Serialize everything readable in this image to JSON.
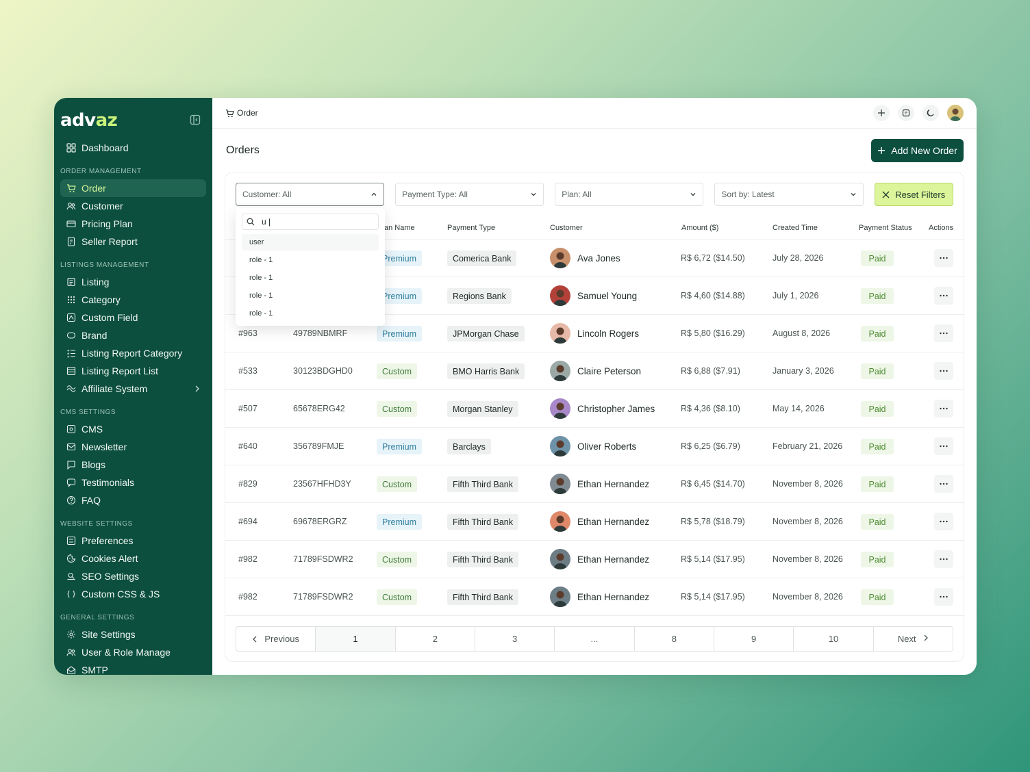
{
  "app": {
    "logo_main": "adv",
    "logo_accent": "az"
  },
  "sidebar": {
    "sections": [
      {
        "title": "ORDER MANAGEMENT",
        "items": [
          {
            "label": "Order",
            "icon": "cart-icon",
            "active": true
          },
          {
            "label": "Customer",
            "icon": "users-icon"
          },
          {
            "label": "Pricing Plan",
            "icon": "card-icon"
          },
          {
            "label": "Seller Report",
            "icon": "report-icon"
          }
        ]
      },
      {
        "title": "LISTINGS MANAGEMENT",
        "items": [
          {
            "label": "Listing",
            "icon": "list-icon"
          },
          {
            "label": "Category",
            "icon": "grid-dots-icon"
          },
          {
            "label": "Custom Field",
            "icon": "field-icon"
          },
          {
            "label": "Brand",
            "icon": "tag-icon"
          },
          {
            "label": "Listing Report Category",
            "icon": "list-check-icon"
          },
          {
            "label": "Listing Report List",
            "icon": "rows-icon"
          },
          {
            "label": "Affiliate System",
            "icon": "affiliate-icon",
            "chevron": true
          }
        ]
      },
      {
        "title": "CMS SETTINGS",
        "items": [
          {
            "label": "CMS",
            "icon": "cms-icon"
          },
          {
            "label": "Newsletter",
            "icon": "newsletter-icon"
          },
          {
            "label": "Blogs",
            "icon": "blog-icon"
          },
          {
            "label": "Testimonials",
            "icon": "chat-icon"
          },
          {
            "label": "FAQ",
            "icon": "help-icon"
          }
        ]
      },
      {
        "title": "WEBSITE SETTINGS",
        "items": [
          {
            "label": "Preferences",
            "icon": "sliders-icon"
          },
          {
            "label": "Cookies Alert",
            "icon": "cookie-icon"
          },
          {
            "label": "SEO Settings",
            "icon": "seo-icon"
          },
          {
            "label": "Custom CSS & JS",
            "icon": "code-icon"
          }
        ]
      },
      {
        "title": "GENERAL SETTINGS",
        "items": [
          {
            "label": "Site Settings",
            "icon": "gear-icon"
          },
          {
            "label": "User & Role Manage",
            "icon": "users-icon"
          },
          {
            "label": "SMTP",
            "icon": "mail-icon"
          }
        ]
      }
    ]
  },
  "topbar": {
    "breadcrumb": "Order"
  },
  "page": {
    "title": "Orders",
    "add_button": "Add New Order"
  },
  "filters": {
    "customer": "Customer: All",
    "payment_type": "Payment Type: All",
    "plan": "Plan: All",
    "sort": "Sort by: Latest",
    "reset": "Reset Filters"
  },
  "dropdown": {
    "search_value": "u |",
    "options": [
      "user",
      "role - 1",
      "role - 1",
      "role - 1",
      "role - 1"
    ]
  },
  "table": {
    "headers": {
      "plan_name": "an Name",
      "payment_type": "Payment Type",
      "customer": "Customer",
      "amount": "Amount ($)",
      "created": "Created Time",
      "status": "Payment Status",
      "actions": "Actions"
    },
    "rows": [
      {
        "id": "",
        "txn": "",
        "plan": "Premium",
        "bank": "Comerica Bank",
        "customer": "Ava Jones",
        "amount": "R$ 6,72 ($14.50)",
        "created": "July 28, 2026",
        "status": "Paid",
        "avatar_color": "#c8906a"
      },
      {
        "id": "",
        "txn": "",
        "plan": "Premium",
        "bank": "Regions Bank",
        "customer": "Samuel Young",
        "amount": "R$ 4,60 ($14.88)",
        "created": "July 1, 2026",
        "status": "Paid",
        "avatar_color": "#b2413a"
      },
      {
        "id": "#963",
        "txn": "49789NBMRF",
        "plan": "Premium",
        "bank": "JPMorgan Chase",
        "customer": "Lincoln Rogers",
        "amount": "R$ 5,80 ($16.29)",
        "created": "August 8, 2026",
        "status": "Paid",
        "avatar_color": "#e7b9a8"
      },
      {
        "id": "#533",
        "txn": "30123BDGHD0",
        "plan": "Custom",
        "bank": "BMO Harris Bank",
        "customer": "Claire Peterson",
        "amount": "R$ 6,88 ($7.91)",
        "created": "January 3, 2026",
        "status": "Paid",
        "avatar_color": "#9aa8a6"
      },
      {
        "id": "#507",
        "txn": "65678ERG42",
        "plan": "Custom",
        "bank": "Morgan Stanley",
        "customer": "Christopher James",
        "amount": "R$ 4,36 ($8.10)",
        "created": "May 14, 2026",
        "status": "Paid",
        "avatar_color": "#a888c8"
      },
      {
        "id": "#640",
        "txn": "356789FMJE",
        "plan": "Premium",
        "bank": "Barclays",
        "customer": "Oliver Roberts",
        "amount": "R$ 6,25 ($6.79)",
        "created": "February 21, 2026",
        "status": "Paid",
        "avatar_color": "#6e93a8"
      },
      {
        "id": "#829",
        "txn": "23567HFHD3Y",
        "plan": "Custom",
        "bank": "Fifth Third Bank",
        "customer": "Ethan Hernandez",
        "amount": "R$ 6,45 ($14.70)",
        "created": "November 8, 2026",
        "status": "Paid",
        "avatar_color": "#7f8a92"
      },
      {
        "id": "#694",
        "txn": "69678ERGRZ",
        "plan": "Premium",
        "bank": "Fifth Third Bank",
        "customer": "Ethan Hernandez",
        "amount": "R$ 5,78 ($18.79)",
        "created": "November 8, 2026",
        "status": "Paid",
        "avatar_color": "#e0896a"
      },
      {
        "id": "#982",
        "txn": "71789FSDWR2",
        "plan": "Custom",
        "bank": "Fifth Third Bank",
        "customer": "Ethan Hernandez",
        "amount": "R$ 5,14 ($17.95)",
        "created": "November 8, 2026",
        "status": "Paid",
        "avatar_color": "#6d7d86"
      },
      {
        "id": "#982",
        "txn": "71789FSDWR2",
        "plan": "Custom",
        "bank": "Fifth Third Bank",
        "customer": "Ethan Hernandez",
        "amount": "R$ 5,14 ($17.95)",
        "created": "November 8, 2026",
        "status": "Paid",
        "avatar_color": "#6d7d86"
      }
    ]
  },
  "pagination": {
    "previous": "Previous",
    "next": "Next",
    "pages": [
      "1",
      "2",
      "3",
      "...",
      "8",
      "9",
      "10"
    ],
    "current": "1"
  },
  "colors": {
    "sidebar": "#0d4f3f",
    "accent": "#c9f27a",
    "primary": "#0d4f3f",
    "reset": "#dcf49a"
  }
}
